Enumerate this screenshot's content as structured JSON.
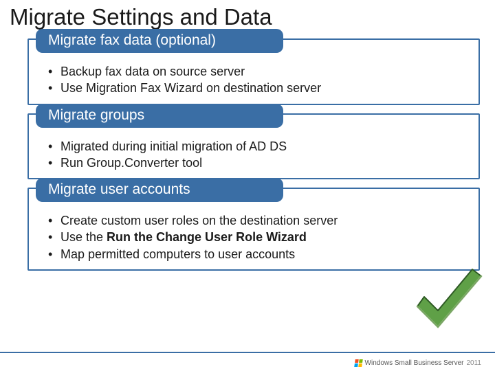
{
  "title": "Migrate Settings and Data",
  "sections": [
    {
      "header": "Migrate fax data (optional)",
      "bullets": [
        [
          {
            "text": "Backup fax data on source server",
            "bold": false
          }
        ],
        [
          {
            "text": "Use Migration Fax Wizard on destination server",
            "bold": false
          }
        ]
      ]
    },
    {
      "header": "Migrate groups",
      "bullets": [
        [
          {
            "text": "Migrated during initial migration of AD DS",
            "bold": false
          }
        ],
        [
          {
            "text": "Run Group.Converter tool",
            "bold": false
          }
        ]
      ]
    },
    {
      "header": "Migrate user accounts",
      "bullets": [
        [
          {
            "text": "Create custom user roles on the destination server",
            "bold": false
          }
        ],
        [
          {
            "text": "Use the ",
            "bold": false
          },
          {
            "text": "Run the Change User Role Wizard",
            "bold": true
          }
        ],
        [
          {
            "text": "Map permitted computers to user accounts",
            "bold": false
          }
        ]
      ]
    }
  ],
  "footer": {
    "brand": "Windows Small Business Server",
    "year": "2011"
  }
}
